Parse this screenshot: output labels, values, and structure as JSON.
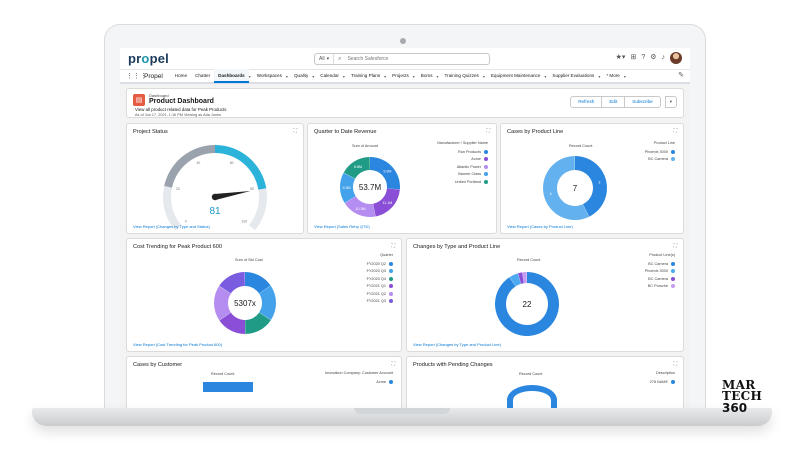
{
  "app": {
    "logo_main": "pr",
    "logo_accent": "o",
    "logo_tail": "pel",
    "app_name": "Propel"
  },
  "search": {
    "scope": "All",
    "placeholder": "Search Salesforce"
  },
  "nav": {
    "items": [
      {
        "label": "Home",
        "caret": false,
        "active": false
      },
      {
        "label": "Chatter",
        "caret": false,
        "active": false
      },
      {
        "label": "Dashboards",
        "caret": true,
        "active": true
      },
      {
        "label": "Workspaces",
        "caret": true,
        "active": false
      },
      {
        "label": "Quality",
        "caret": true,
        "active": false
      },
      {
        "label": "Calendar",
        "caret": true,
        "active": false
      },
      {
        "label": "Training Plans",
        "caret": true,
        "active": false
      },
      {
        "label": "Projects",
        "caret": true,
        "active": false
      },
      {
        "label": "Boms",
        "caret": true,
        "active": false
      },
      {
        "label": "Training Quizzes",
        "caret": true,
        "active": false
      },
      {
        "label": "Equipment Maintenance",
        "caret": true,
        "active": false
      },
      {
        "label": "Supplier Evaluations",
        "caret": true,
        "active": false
      },
      {
        "label": "* More",
        "caret": true,
        "active": false
      }
    ]
  },
  "dashboard": {
    "type": "Dashboard",
    "title": "Product Dashboard",
    "description": "View all product related data for Peak Products",
    "as_of": "As of Jun 17, 2021, 1:16 PM Viewing as Ada Jones",
    "buttons": {
      "refresh": "Refresh",
      "edit": "Edit",
      "subscribe": "Subscribe"
    }
  },
  "cards": {
    "project_status": {
      "title": "Project Status",
      "value": "81",
      "ticks": [
        "0",
        "10",
        "20",
        "30",
        "40",
        "50",
        "60",
        "70",
        "80",
        "90",
        "100"
      ],
      "link": "View Report (Changes by Type and Status)"
    },
    "revenue": {
      "title": "Quarter to Date Revenue",
      "axis": "Sum of Amount",
      "center": "53.7M",
      "legend_title": "Manufacturer / Supplier Name",
      "link": "View Report (Sales Rehp QTD)"
    },
    "cases_line": {
      "title": "Cases by Product Line",
      "axis": "Record Count",
      "center": "7",
      "legend_title": "Product Line",
      "link": "View Report (Cases by Product Line)"
    },
    "cost": {
      "title": "Cost Trending for Peak Product 600",
      "axis": "Sum of Std Cost",
      "center": "5307x",
      "legend_title": "Quarter",
      "link": "View Report (Cost Trending for Peak Product 600)"
    },
    "changes": {
      "title": "Changes by Type and Product Line",
      "axis": "Record Count",
      "center": "22",
      "legend_title": "Product Line(s)",
      "link": "View Report (Changes by Type and Product Line)"
    },
    "cases_customer": {
      "title": "Cases by Customer",
      "axis": "Record Count",
      "legend_title": "Innovation Company: Customer Account",
      "legend_first": "Acme"
    },
    "pending": {
      "title": "Products with Pending Changes",
      "axis": "Record Count",
      "legend_title": "Description",
      "legend_first": "278 NAME"
    }
  },
  "chart_data": [
    {
      "type": "gauge",
      "title": "Project Status",
      "value": 81,
      "range": [
        0,
        100
      ]
    },
    {
      "type": "pie",
      "title": "Quarter to Date Revenue",
      "center_label": "53.7M",
      "categories": [
        "Run Products",
        "Acme",
        "Atlantic Power",
        "Banner Class",
        "United Portland"
      ],
      "values": [
        14,
        11,
        10,
        9,
        9
      ],
      "colors": [
        "#2a86de",
        "#8a4fd6",
        "#b58df0",
        "#43a2ea",
        "#1f9b86"
      ],
      "segment_labels": [
        "9.9M",
        "11.1M",
        "10.3M",
        "9.3M",
        "8.8M"
      ]
    },
    {
      "type": "pie",
      "title": "Cases by Product Line",
      "center_label": "7",
      "categories": [
        "Phoenix 3000",
        "BC Camera"
      ],
      "values": [
        3,
        4
      ],
      "colors": [
        "#2a86de",
        "#63b1ee"
      ],
      "segment_labels": [
        "3",
        "4"
      ]
    },
    {
      "type": "pie",
      "title": "Cost Trending for Peak Product 600",
      "center_label": "5307x",
      "categories": [
        "FY2020 Q2",
        "FY2020 Q3",
        "FY2020 Q4",
        "FY2021 Q1",
        "FY2021 Q2",
        "FY2021 Q3"
      ],
      "values": [
        5,
        6,
        5,
        5,
        6,
        5
      ],
      "colors": [
        "#2a86de",
        "#43a2ea",
        "#1f9b86",
        "#8a4fd6",
        "#b58df0",
        "#7a5ce0"
      ],
      "segment_labels": [
        "",
        "",
        "",
        "",
        "",
        ""
      ]
    },
    {
      "type": "pie",
      "title": "Changes by Type and Product Line",
      "center_label": "22",
      "categories": [
        "BC Camera",
        "Phoenix 3000",
        "BC Camera",
        "BC Porsche"
      ],
      "values": [
        20,
        1,
        0.5,
        0.5
      ],
      "colors": [
        "#2a86de",
        "#4eaaf0",
        "#8a4fd6",
        "#c59cf2"
      ],
      "segment_labels": [
        "",
        "",
        "",
        ""
      ]
    }
  ],
  "watermark": {
    "line1": "MAR",
    "line2": "TECH",
    "line3": "360"
  }
}
